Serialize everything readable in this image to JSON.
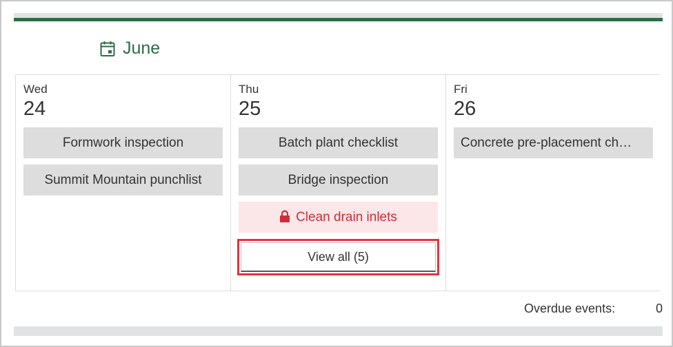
{
  "calendar": {
    "month": "June",
    "days": [
      {
        "dow": "Wed",
        "num": "24",
        "events": [
          {
            "label": "Formwork inspection"
          },
          {
            "label": "Summit Mountain punchlist"
          }
        ]
      },
      {
        "dow": "Thu",
        "num": "25",
        "events": [
          {
            "label": "Batch plant checklist"
          },
          {
            "label": "Bridge inspection"
          },
          {
            "label": "Clean drain inlets",
            "locked": true
          }
        ],
        "view_all_label": "View all (5)"
      },
      {
        "dow": "Fri",
        "num": "26",
        "events": [
          {
            "label": "Concrete pre-placement ch…"
          }
        ]
      }
    ]
  },
  "footer": {
    "overdue_label": "Overdue events:",
    "overdue_count": "0"
  },
  "colors": {
    "accent_green": "#2f6b47",
    "locked_red": "#d02b3a",
    "locked_bg": "#fbe7e7",
    "highlight_red": "#e8313d"
  },
  "icons": {
    "month": "calendar-icon",
    "locked_event": "lock-icon"
  }
}
